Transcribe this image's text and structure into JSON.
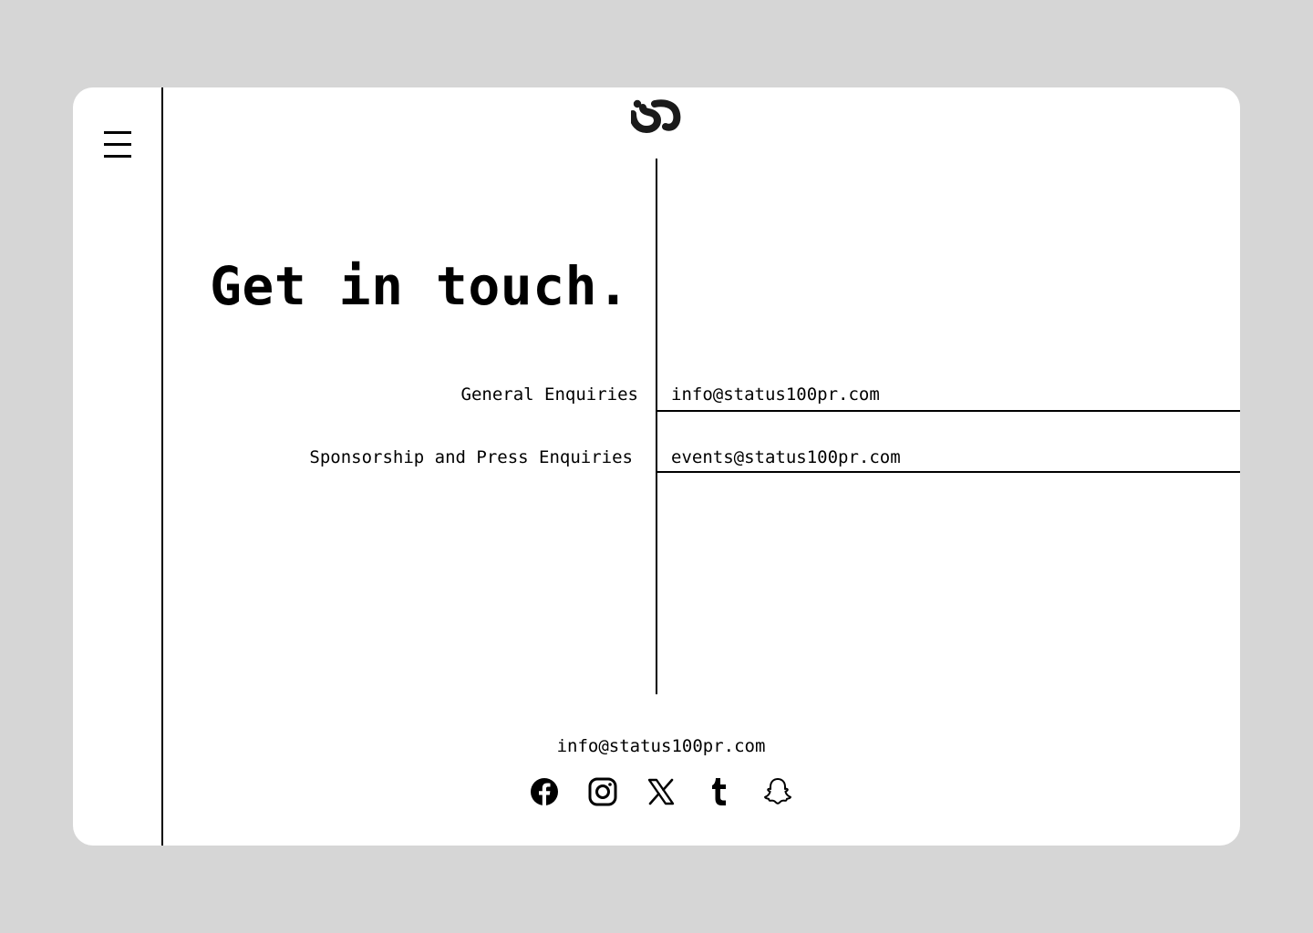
{
  "header": {
    "menu_icon": "hamburger-menu-icon",
    "logo_icon": "s-monogram-logo"
  },
  "main": {
    "title": "Get in touch.",
    "enquiries": [
      {
        "label": "General Enquiries",
        "email": "info@status100pr.com"
      },
      {
        "label": "Sponsorship and Press Enquiries",
        "email": "events@status100pr.com"
      }
    ]
  },
  "footer": {
    "email": "info@status100pr.com",
    "socials": [
      {
        "icon": "facebook-icon"
      },
      {
        "icon": "instagram-icon"
      },
      {
        "icon": "x-twitter-icon"
      },
      {
        "icon": "tumblr-icon"
      },
      {
        "icon": "snapchat-icon"
      }
    ]
  },
  "colors": {
    "background": "#d6d6d6",
    "card": "#ffffff",
    "ink": "#000000"
  }
}
